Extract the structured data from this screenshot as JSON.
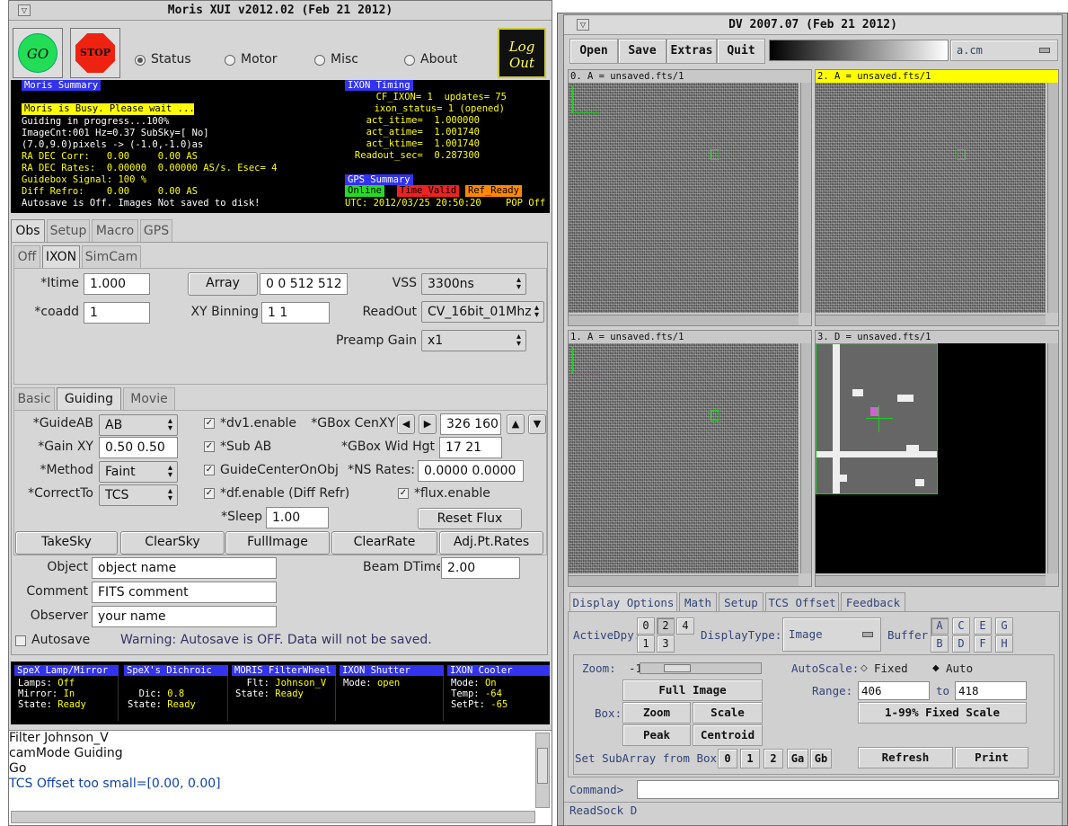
{
  "moris": {
    "title": "Moris XUI v2012.02 (Feb 21 2012)",
    "go": "GO",
    "stop": "STOP",
    "logout1": "Log",
    "logout2": "Out",
    "radios": [
      {
        "label": "Status",
        "selected": true
      },
      {
        "label": "Motor"
      },
      {
        "label": "Misc"
      },
      {
        "label": "About"
      }
    ],
    "summary": {
      "header": "Moris Summary",
      "busy": "Moris is Busy. Please wait ...",
      "lines": [
        "Guiding in progress...100%",
        "ImageCnt:001 Hz=0.37 SubSky=[ No]",
        "(7.0,9.0)pixels -> (-1.0,-1.0)as",
        "RA DEC Corr:   0.00     0.00 AS",
        "RA DEC Rates:  0.00000  0.00000 AS/s. Esec= 4",
        "Guidebox Signal: 100 %",
        "Diff Refro:    0.00     0.00 AS",
        "Autosave is Off. Images Not saved to disk!"
      ]
    },
    "timing": {
      "header": "IXON Timing",
      "lines": [
        "CF_IXON= 1  updates= 75",
        "ixon_status= 1 (opened)",
        "act_itime=  1.000000",
        "act_atime=  1.001740",
        "act_ktime=  1.001740",
        "Readout_sec=  0.287300"
      ]
    },
    "gps": {
      "header": "GPS Summary",
      "online": "Online",
      "time_valid": "Time_Valid",
      "ref_ready": "Ref_Ready",
      "utc": "UTC: 2012/03/25 20:50:20",
      "pop": "POP Off"
    },
    "tabs1": [
      "Obs",
      "Setup",
      "Macro",
      "GPS"
    ],
    "tabs2": [
      "Off",
      "IXON",
      "SimCam"
    ],
    "ixon": {
      "itime_label": "*Itime",
      "itime": "1.000",
      "coadd_label": "*coadd",
      "coadd": "1",
      "array_btn": "Array",
      "array": "0 0 512 512",
      "xybin_label": "XY Binning",
      "xybin": "1 1",
      "vss_label": "VSS",
      "vss": "3300ns",
      "readout_label": "ReadOut",
      "readout": "CV_16bit_01Mhz",
      "preamp_label": "Preamp Gain",
      "preamp": "x1"
    },
    "tabs3": [
      "Basic",
      "Guiding",
      "Movie"
    ],
    "guide": {
      "guideab_label": "*GuideAB",
      "guideab": "AB",
      "gainxy_label": "*Gain XY",
      "gainxy": "0.50 0.50",
      "method_label": "*Method",
      "method": "Faint",
      "correct_label": "*CorrectTo",
      "correct": "TCS",
      "dv1": "*dv1.enable",
      "subab": "*Sub AB",
      "gcoo": "GuideCenterOnObj",
      "dfen": "*df.enable (Diff Refr)",
      "flux": "*flux.enable",
      "gbox_label": "*GBox CenXY",
      "gbox": "326 160",
      "gboxwh_label": "*GBox Wid Hgt",
      "gboxwh": "17 21",
      "ns_label": "*NS Rates:",
      "ns": "0.0000 0.0000",
      "sleep_label": "*Sleep",
      "sleep": "1.00",
      "reset": "Reset Flux"
    },
    "actions": [
      "TakeSky",
      "ClearSky",
      "FullImage",
      "ClearRate",
      "Adj.Pt.Rates"
    ],
    "object_label": "Object",
    "object": "object name",
    "comment_label": "Comment",
    "comment": "FITS comment",
    "observer_label": "Observer",
    "observer": "your name",
    "beam_label": "Beam DTime",
    "beam": "2.00",
    "autosave": "Autosave",
    "warning": "Warning: Autosave is OFF. Data will not be saved.",
    "status_panels": [
      {
        "header": "SpeX Lamp/Mirror",
        "lines": [
          [
            "Lamps: ",
            "Off"
          ],
          [
            "Mirror: ",
            "In"
          ],
          [
            "State: ",
            "Ready"
          ]
        ]
      },
      {
        "header": "SpeX's Dichroic",
        "lines": [
          [
            "",
            ""
          ],
          [
            "  Dic: ",
            "0.8"
          ],
          [
            "State: ",
            "Ready"
          ]
        ]
      },
      {
        "header": "MORIS FilterWheel",
        "lines": [
          [
            "  Flt: ",
            "Johnson_V"
          ],
          [
            "State: ",
            "Ready"
          ],
          [
            "",
            ""
          ]
        ]
      },
      {
        "header": "IXON Shutter",
        "lines": [
          [
            "Mode: ",
            "open"
          ],
          [
            "",
            ""
          ],
          [
            "",
            ""
          ]
        ]
      },
      {
        "header": "IXON Cooler",
        "lines": [
          [
            "Mode: ",
            "On"
          ],
          [
            "Temp: ",
            "-64"
          ],
          [
            "SetPt: ",
            "-65"
          ]
        ]
      }
    ],
    "log": [
      "Filter Johnson_V",
      "camMode Guiding",
      "Go",
      "TCS Offset too small=[0.00, 0.00]"
    ]
  },
  "dv": {
    "title": "DV 2007.07 (Feb 21 2012)",
    "menu": [
      "Open",
      "Save",
      "Extras",
      "Quit"
    ],
    "cmap": "a.cm",
    "frames": [
      "0. A = unsaved.fts/1",
      "2. A = unsaved.fts/1",
      "1. A = unsaved.fts/1",
      "3. D = unsaved.fts/1"
    ],
    "tabs": [
      "Display Options",
      "Math",
      "Setup",
      "TCS Offset",
      "Feedback"
    ],
    "activedpy_label": "ActiveDpy:",
    "dpy": [
      "0",
      "2",
      "4",
      "1",
      "3"
    ],
    "displaytype_label": "DisplayType:",
    "displaytype": "Image",
    "buffer_label": "Buffer:",
    "buffers": [
      "A",
      "C",
      "E",
      "G",
      "B",
      "D",
      "F",
      "H"
    ],
    "zoom_label": "Zoom:",
    "zoom_val": "-1",
    "autoscale_label": "AutoScale:",
    "fixed": "Fixed",
    "auto": "Auto",
    "range_label": "Range:",
    "range_min": "406",
    "to": "to",
    "range_max": "418",
    "fullimage": "Full Image",
    "box_label": "Box:",
    "zoom_btn": "Zoom",
    "scale_btn": "Scale",
    "peak_btn": "Peak",
    "centroid_btn": "Centroid",
    "fixedscale": "1-99% Fixed Scale",
    "subarray_label": "Set SubArray from Box:",
    "sub": [
      "0",
      "1",
      "2",
      "Ga",
      "Gb"
    ],
    "refresh": "Refresh",
    "print": "Print",
    "command_label": "Command>",
    "readsock": "ReadSock D"
  }
}
